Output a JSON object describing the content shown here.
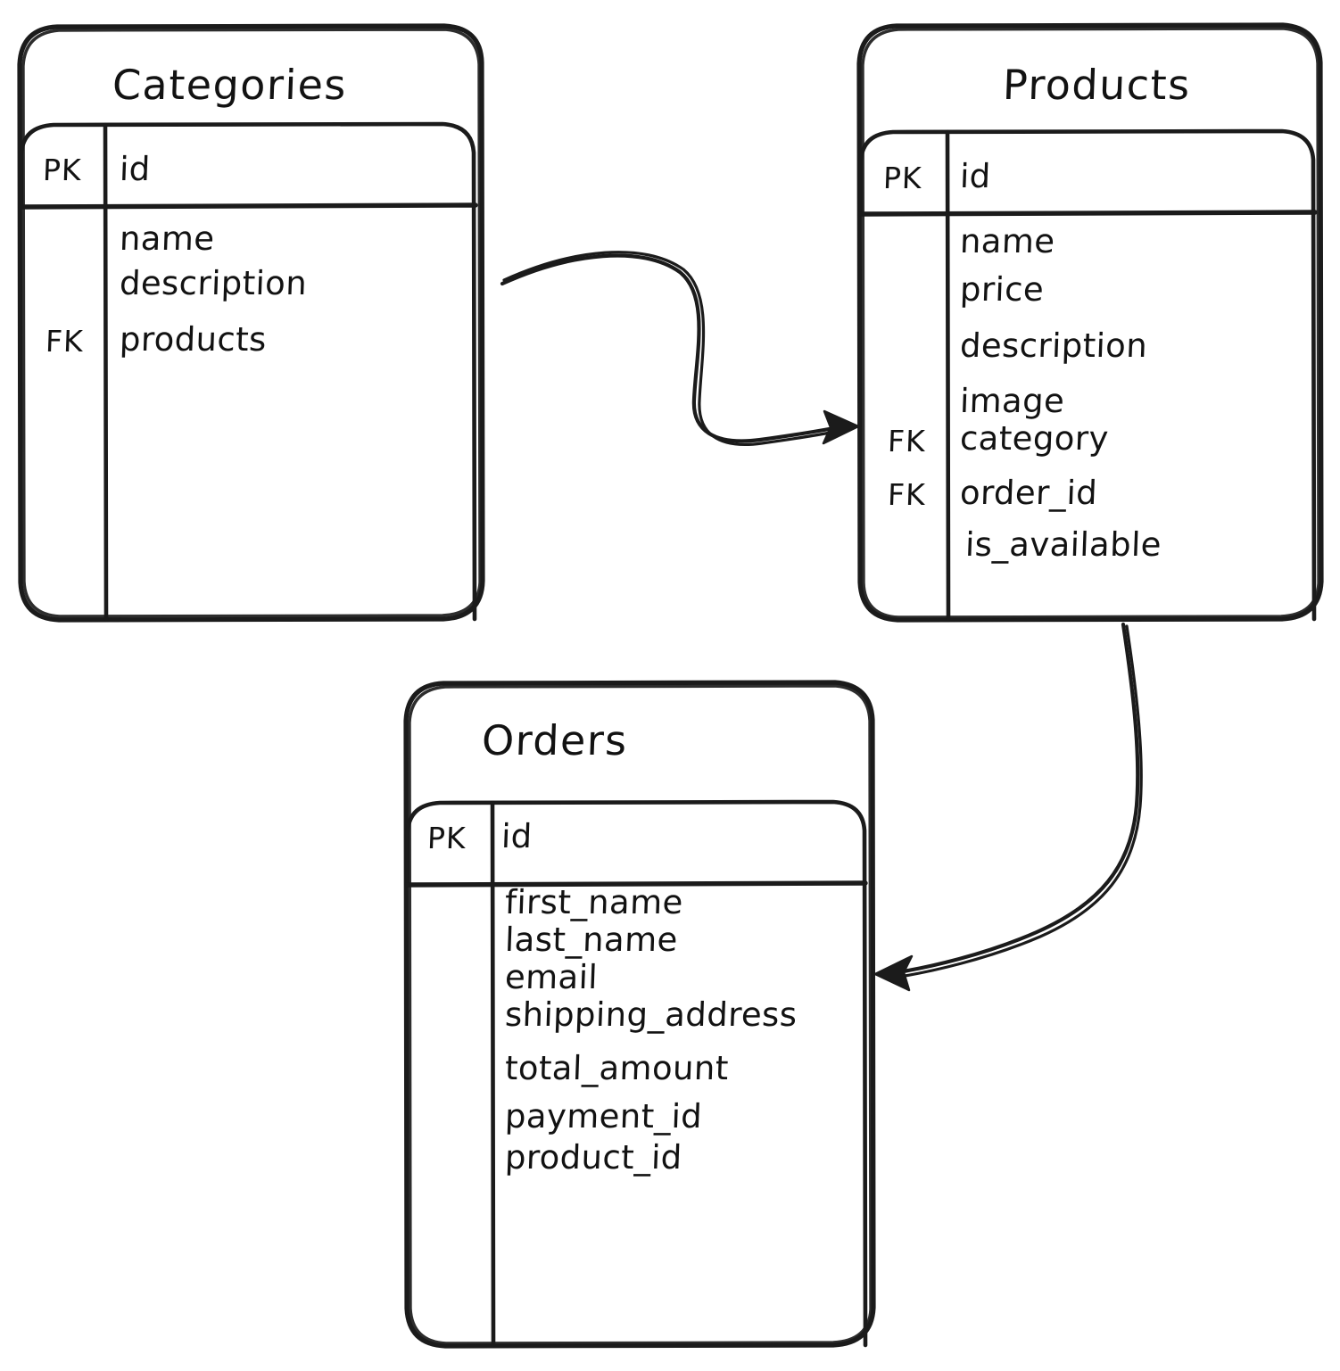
{
  "diagram": {
    "kind": "entity-relationship-diagram",
    "style": "hand-drawn",
    "stroke_color": "#1b1b1b",
    "background_color": "#ffffff"
  },
  "entities": [
    {
      "id": "categories",
      "title": "Categories",
      "primary_key_tag": "PK",
      "primary_key_field": "id",
      "fields": [
        {
          "tag": "",
          "name": "name"
        },
        {
          "tag": "",
          "name": "description"
        },
        {
          "tag": "FK",
          "name": "products"
        }
      ]
    },
    {
      "id": "products",
      "title": "Products",
      "primary_key_tag": "PK",
      "primary_key_field": "id",
      "fields": [
        {
          "tag": "",
          "name": "name"
        },
        {
          "tag": "",
          "name": "price"
        },
        {
          "tag": "",
          "name": "description"
        },
        {
          "tag": "",
          "name": "image"
        },
        {
          "tag": "FK",
          "name": "category"
        },
        {
          "tag": "FK",
          "name": "order_id"
        },
        {
          "tag": "",
          "name": "is_available"
        }
      ]
    },
    {
      "id": "orders",
      "title": "Orders",
      "primary_key_tag": "PK",
      "primary_key_field": "id",
      "fields": [
        {
          "tag": "",
          "name": "first_name"
        },
        {
          "tag": "",
          "name": "last_name"
        },
        {
          "tag": "",
          "name": "email"
        },
        {
          "tag": "",
          "name": "shipping_address"
        },
        {
          "tag": "",
          "name": "total_amount"
        },
        {
          "tag": "",
          "name": "payment_id"
        },
        {
          "tag": "",
          "name": "product_id"
        }
      ]
    }
  ],
  "relationships": [
    {
      "id": "categories-to-products",
      "from": "categories",
      "to": "products",
      "arrow": "single-head"
    },
    {
      "id": "products-to-orders",
      "from": "products",
      "to": "orders",
      "arrow": "single-head"
    }
  ]
}
